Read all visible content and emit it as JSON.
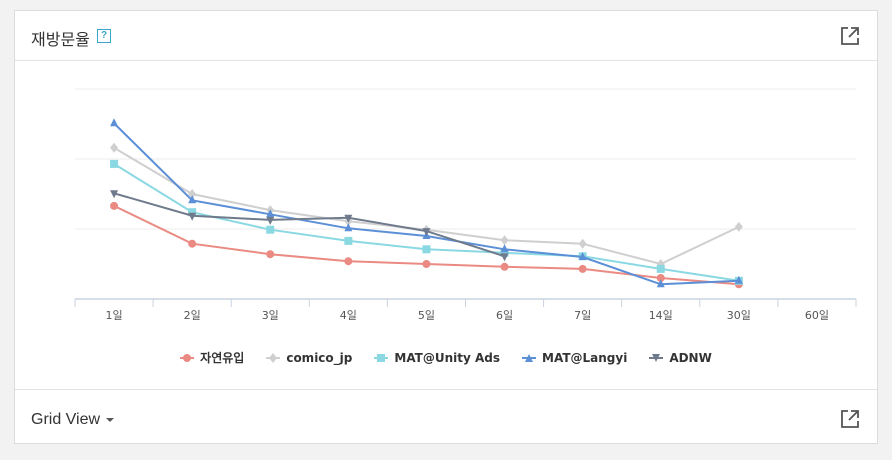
{
  "header": {
    "title": "재방문율",
    "help_icon": "help-icon",
    "export_icon": "external-link-icon"
  },
  "footer": {
    "grid_view_label": "Grid View",
    "dropdown_icon": "caret-down-icon",
    "export_icon": "external-link-icon"
  },
  "chart_data": {
    "type": "line",
    "categories": [
      "1일",
      "2일",
      "3일",
      "4일",
      "5일",
      "6일",
      "7일",
      "14일",
      "30일",
      "60일"
    ],
    "ylim": [
      0,
      3
    ],
    "grid": true,
    "legend_position": "bottom-center",
    "series": [
      {
        "name": "자연유입",
        "color": "#ea8a82",
        "marker": "circle",
        "values": [
          1.33,
          0.79,
          0.64,
          0.54,
          0.5,
          0.46,
          0.43,
          0.3,
          0.21,
          null
        ]
      },
      {
        "name": "comico_jp",
        "color": "#cfcfcf",
        "marker": "diamond",
        "values": [
          2.16,
          1.5,
          1.27,
          1.11,
          0.99,
          0.84,
          0.79,
          0.5,
          1.03,
          null
        ]
      },
      {
        "name": "MAT@Unity Ads",
        "color": "#8ad8e2",
        "marker": "square",
        "values": [
          1.93,
          1.24,
          0.99,
          0.83,
          0.71,
          0.66,
          0.61,
          0.43,
          0.26,
          null
        ]
      },
      {
        "name": "MAT@Langyi",
        "color": "#5b8fd6",
        "marker": "triangle-up",
        "values": [
          2.51,
          1.41,
          1.21,
          1.01,
          0.9,
          0.71,
          0.6,
          0.21,
          0.26,
          null
        ]
      },
      {
        "name": "ADNW",
        "color": "#6f7b8c",
        "marker": "triangle-down",
        "values": [
          1.51,
          1.19,
          1.13,
          1.16,
          0.97,
          0.61,
          null,
          null,
          null,
          null
        ]
      }
    ]
  }
}
